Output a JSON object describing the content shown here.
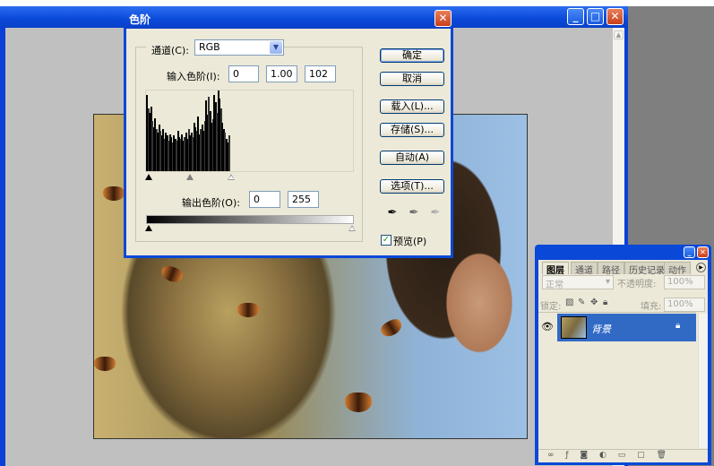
{
  "document_window": {
    "controls": {
      "minimize": "_",
      "maximize": "□",
      "close": "✕"
    }
  },
  "levels_dialog": {
    "title": "色阶",
    "close_icon": "✕",
    "channel_label": "通道(C):",
    "channel_value": "RGB",
    "input_levels_label": "输入色阶(I):",
    "input_black": "0",
    "input_gamma": "1.00",
    "input_white": "102",
    "output_levels_label": "输出色阶(O):",
    "output_black": "0",
    "output_white": "255",
    "buttons": {
      "ok": "确定",
      "cancel": "取消",
      "load": "载入(L)...",
      "save": "存储(S)...",
      "auto": "自动(A)",
      "options": "选项(T)..."
    },
    "preview_label": "预览(P)",
    "preview_checked": true,
    "histogram": [
      95,
      78,
      72,
      80,
      62,
      55,
      66,
      52,
      48,
      58,
      50,
      45,
      52,
      40,
      48,
      44,
      38,
      46,
      42,
      36,
      44,
      40,
      38,
      50,
      42,
      40,
      46,
      38,
      42,
      48,
      40,
      52,
      44,
      48,
      42,
      60,
      55,
      50,
      68,
      46,
      52,
      58,
      50,
      62,
      88,
      70,
      92,
      75,
      60,
      65,
      94,
      86,
      72,
      100,
      90,
      78,
      60,
      52,
      48,
      40,
      36,
      44
    ],
    "histogram_range": [
      0,
      102
    ]
  },
  "layers_panel": {
    "tabs": [
      "图层",
      "通道",
      "路径",
      "历史记录",
      "动作"
    ],
    "blend_mode": "正常",
    "opacity_label": "不透明度:",
    "opacity_value": "100%",
    "lock_label": "锁定:",
    "fill_label": "填充:",
    "fill_value": "100%",
    "layers": [
      {
        "name": "背景",
        "visible": true,
        "locked": true
      }
    ]
  }
}
